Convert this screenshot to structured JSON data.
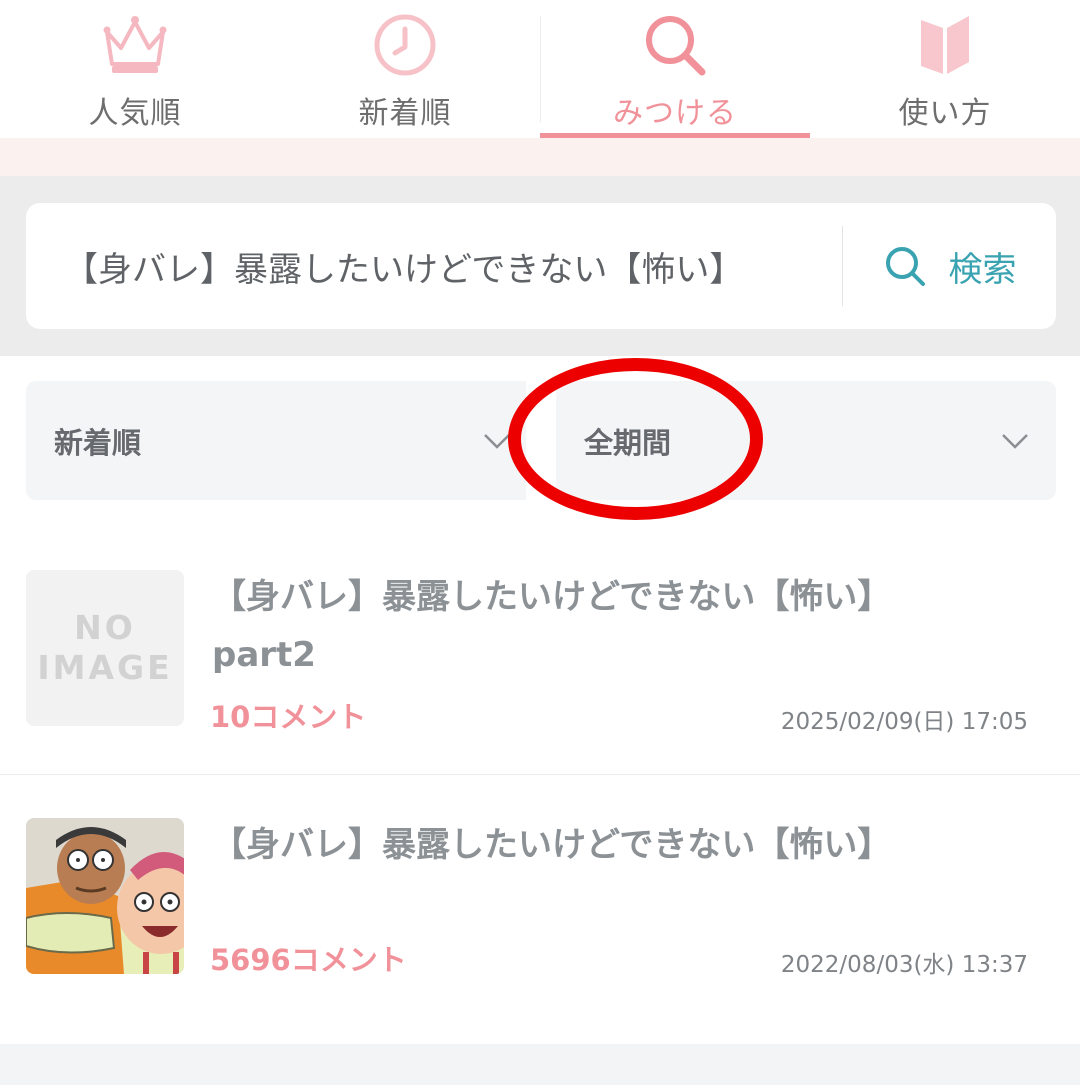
{
  "tabs": [
    {
      "label": "人気順",
      "icon": "crown-icon"
    },
    {
      "label": "新着順",
      "icon": "clock-icon"
    },
    {
      "label": "みつける",
      "icon": "search-icon",
      "active": true
    },
    {
      "label": "使い方",
      "icon": "book-icon"
    }
  ],
  "search": {
    "value": "【身バレ】暴露したいけどできない【怖い】",
    "button_label": "検索"
  },
  "filters": {
    "sort_label": "新着順",
    "period_label": "全期間"
  },
  "items": [
    {
      "title_line1": "【身バレ】暴露したいけどできない【怖い】",
      "title_line2": "part2",
      "comments": "10コメント",
      "date": "2025/02/09(日) 17:05",
      "thumb": {
        "line1": "NO",
        "line2": "IMAGE"
      }
    },
    {
      "title_line1": "【身バレ】暴露したいけどできない【怖い】",
      "comments": "5696コメント",
      "date": "2022/08/03(水) 13:37"
    }
  ],
  "colors": {
    "accent_pink": "#f1929a",
    "search_teal": "#3aa3b1",
    "highlight_red": "#ec0000"
  }
}
